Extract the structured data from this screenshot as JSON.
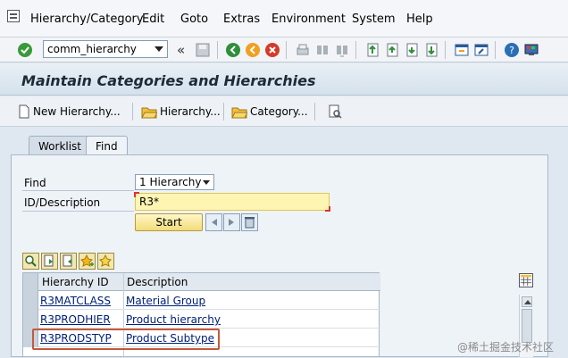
{
  "menubar": {
    "items": [
      "Hierarchy/Category",
      "Edit",
      "Goto",
      "Extras",
      "Environment",
      "System",
      "Help"
    ]
  },
  "toolbar": {
    "command_value": "comm_hierarchy",
    "back_symbol": "«"
  },
  "page": {
    "title": "Maintain Categories and Hierarchies"
  },
  "app_toolbar": {
    "new_hierarchy": "New Hierarchy...",
    "hierarchy": "Hierarchy...",
    "category": "Category..."
  },
  "tabs": [
    "Worklist",
    "Find"
  ],
  "find_form": {
    "find_label": "Find",
    "find_value": "1 Hierarchy",
    "id_label": "ID/Description",
    "id_value": "R3*",
    "start_label": "Start"
  },
  "results": {
    "columns": [
      "Hierarchy ID",
      "Description"
    ],
    "rows": [
      {
        "id": "R3MATCLASS",
        "description": "Material Group"
      },
      {
        "id": "R3PRODHIER",
        "description": "Product hierarchy"
      },
      {
        "id": "R3PRODSTYP",
        "description": "Product Subtype"
      }
    ]
  },
  "watermark": "@稀土掘金技术社区",
  "colors": {
    "title_bar": "#d5e1ec",
    "input_highlight": "#fff5b3",
    "row_highlight_border": "#c45a3a"
  }
}
